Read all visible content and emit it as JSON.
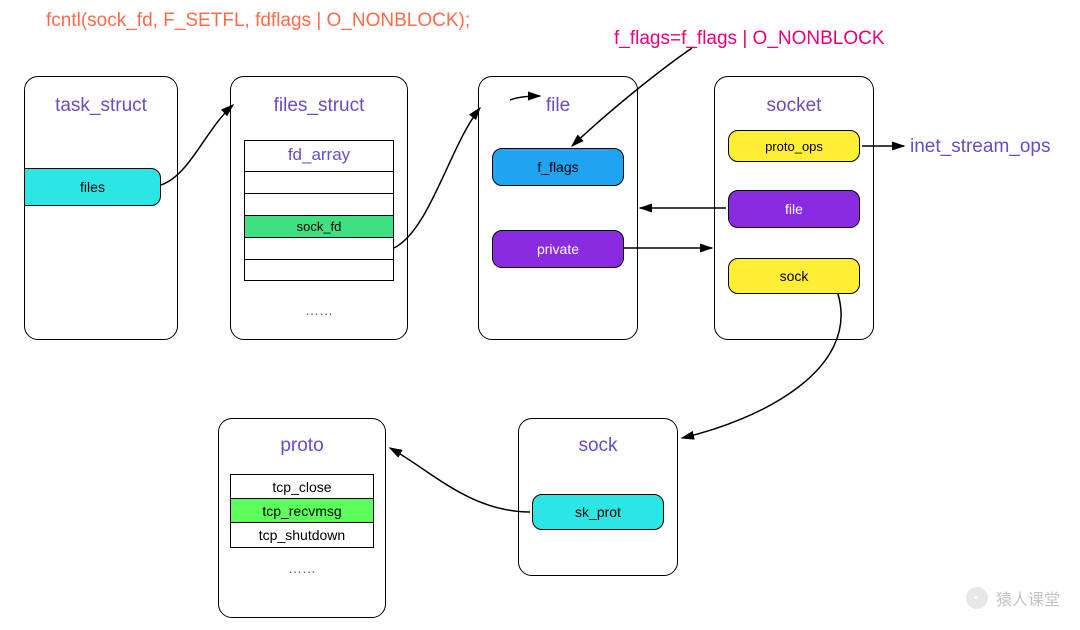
{
  "code": {
    "fcntl": "fcntl(sock_fd, F_SETFL, fdflags | O_NONBLOCK);",
    "fflags": "f_flags=f_flags | O_NONBLOCK"
  },
  "task_struct": {
    "title": "task_struct",
    "files": "files"
  },
  "files_struct": {
    "title": "files_struct",
    "fd_array": "fd_array",
    "sock_fd": "sock_fd",
    "dots": "……"
  },
  "file": {
    "title": "file",
    "f_flags": "f_flags",
    "private": "private"
  },
  "socket": {
    "title": "socket",
    "proto_ops": "proto_ops",
    "file": "file",
    "sock": "sock",
    "ext": "inet_stream_ops"
  },
  "sock": {
    "title": "sock",
    "sk_prot": "sk_prot"
  },
  "proto": {
    "title": "proto",
    "rows": [
      "tcp_close",
      "tcp_recvmsg",
      "tcp_shutdown"
    ],
    "dots": "……"
  },
  "watermark": "猿人课堂",
  "colors": {
    "cyan": "#2ce6e6",
    "green": "#3fe081",
    "limegreen": "#5cff5c",
    "blue": "#1ea4f0",
    "purple": "#8a2be2",
    "yellow": "#ffee33",
    "purpleText": "#6a4cc4"
  }
}
